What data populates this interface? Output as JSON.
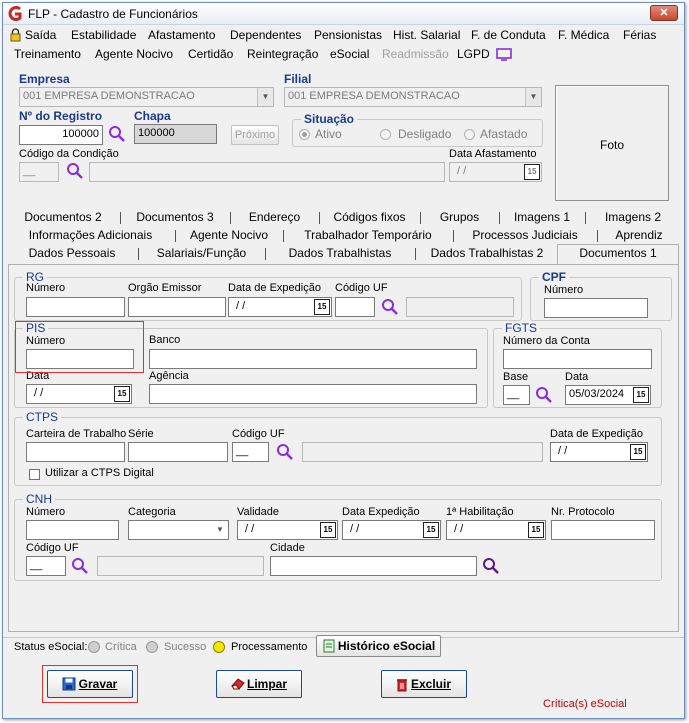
{
  "window": {
    "title": "FLP - Cadastro de Funcionários",
    "close_glyph": "✕"
  },
  "menu": {
    "row1": [
      "Saída",
      "Estabilidade",
      "Afastamento",
      "Dependentes",
      "Pensionistas",
      "Hist. Salarial",
      "F. de Conduta",
      "F. Médica",
      "Férias"
    ],
    "row2": [
      "Treinamento",
      "Agente Nocivo",
      "Certidão",
      "Reintegração",
      "eSocial",
      "Readmissão",
      "LGPD"
    ]
  },
  "header": {
    "empresa_label": "Empresa",
    "empresa_value": "001 EMPRESA DEMONSTRACAO",
    "filial_label": "Filial",
    "filial_value": "001 EMPRESA DEMONSTRACAO",
    "registro_label": "Nº do Registro",
    "registro_value": "100000",
    "chapa_label": "Chapa",
    "chapa_value": "100000",
    "proximo_label": "Próximo",
    "situacao_label": "Situação",
    "situacao_options": [
      "Ativo",
      "Desligado",
      "Afastado"
    ],
    "condicao_label": "Código da Condição",
    "condicao_value": "__",
    "afastamento_label": "Data Afastamento",
    "afastamento_value": "/ /",
    "foto_label": "Foto"
  },
  "tabs": {
    "row1": [
      "Documentos 2",
      "Documentos 3",
      "Endereço",
      "Códigos fixos",
      "Grupos",
      "Imagens 1",
      "Imagens 2"
    ],
    "row2": [
      "Informações Adicionais",
      "Agente Nocivo",
      "Trabalhador Temporário",
      "Processos Judiciais",
      "Aprendiz"
    ],
    "row3": [
      "Dados Pessoais",
      "Salariais/Função",
      "Dados Trabalhistas",
      "Dados Trabalhistas 2",
      "Documentos 1"
    ]
  },
  "rg": {
    "title": "RG",
    "numero_label": "Número",
    "orgao_label": "Orgão Emissor",
    "data_exp_label": "Data de Expedição",
    "data_exp_value": "/ /",
    "codigo_uf_label": "Código UF"
  },
  "cpf": {
    "title": "CPF",
    "numero_label": "Número"
  },
  "pis": {
    "title": "PIS",
    "numero_label": "Número",
    "banco_label": "Banco",
    "data_label": "Data",
    "data_value": "/ /",
    "agencia_label": "Agência"
  },
  "fgts": {
    "title": "FGTS",
    "conta_label": "Número da Conta",
    "base_label": "Base",
    "base_value": "__",
    "data_label": "Data",
    "data_value": "05/03/2024"
  },
  "ctps": {
    "title": "CTPS",
    "carteira_label": "Carteira de Trabalho",
    "serie_label": "Série",
    "codigo_uf_label": "Código UF",
    "codigo_uf_value": "__",
    "data_exp_label": "Data de Expedição",
    "data_exp_value": "/ /",
    "digital_label": "Utilizar a CTPS Digital"
  },
  "cnh": {
    "title": "CNH",
    "numero_label": "Número",
    "categoria_label": "Categoria",
    "validade_label": "Validade",
    "validade_value": "/ /",
    "data_exp_label": "Data Expedição",
    "data_exp_value": "/ /",
    "habilitacao_label": "1ª Habilitação",
    "habilitacao_value": "/ /",
    "protocolo_label": "Nr. Protocolo",
    "codigo_uf_label": "Código UF",
    "codigo_uf_value": "__",
    "cidade_label": "Cidade"
  },
  "status": {
    "label": "Status eSocial:",
    "items": [
      "Crítica",
      "Sucesso",
      "Processamento"
    ],
    "historico_label": "Histórico eSocial",
    "colors": {
      "critica": "#c8c8c8",
      "sucesso": "#c8c8c8",
      "processamento": "#f5e800"
    }
  },
  "actions": {
    "gravar_label": "Gravar",
    "limpar_label": "Limpar",
    "excluir_label": "Excluir",
    "criticas_label": "Crítica(s) eSocial"
  },
  "colors": {
    "accent": "#1a3a8a",
    "highlight": "#e03030",
    "search_icon": "#8a2be2",
    "critica_text": "#c00000"
  }
}
